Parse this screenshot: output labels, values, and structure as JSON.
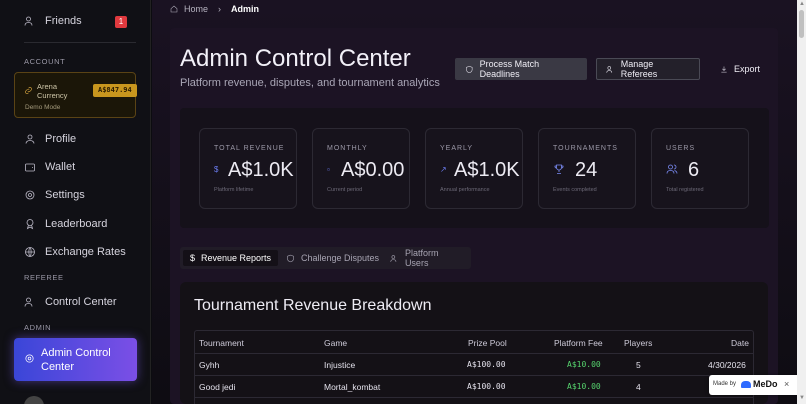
{
  "sidebar": {
    "friends": {
      "label": "Friends",
      "badge": "1"
    },
    "account_section": "ACCOUNT",
    "currency": {
      "label": "Arena Currency",
      "amount": "A$847.94",
      "mode": "Demo Mode"
    },
    "items": [
      {
        "label": "Profile"
      },
      {
        "label": "Wallet"
      },
      {
        "label": "Settings"
      },
      {
        "label": "Leaderboard"
      },
      {
        "label": "Exchange Rates"
      }
    ],
    "referee_section": "REFEREE",
    "control_center": "Control Center",
    "admin_section": "ADMIN",
    "admin_control_center": "Admin Control Center"
  },
  "breadcrumb": {
    "home": "Home",
    "current": "Admin"
  },
  "header": {
    "title": "Admin Control Center",
    "subtitle": "Platform revenue, disputes, and tournament analytics",
    "process_button": "Process Match Deadlines",
    "referees_button": "Manage Referees",
    "export_button": "Export"
  },
  "stats": [
    {
      "label": "TOTAL REVENUE",
      "value": "A$1.0K",
      "note": "Platform lifetime",
      "icon": "dollar-icon"
    },
    {
      "label": "MONTHLY",
      "value": "A$0.00",
      "note": "Current period",
      "icon": "calendar-icon"
    },
    {
      "label": "YEARLY",
      "value": "A$1.0K",
      "note": "Annual performance",
      "icon": "trend-icon"
    },
    {
      "label": "TOURNAMENTS",
      "value": "24",
      "note": "Events completed",
      "icon": "trophy-icon"
    },
    {
      "label": "USERS",
      "value": "6",
      "note": "Total registered",
      "icon": "users-icon"
    }
  ],
  "tabs": [
    {
      "label": "Revenue Reports"
    },
    {
      "label": "Challenge Disputes"
    },
    {
      "label": "Platform Users"
    }
  ],
  "table": {
    "title": "Tournament Revenue Breakdown",
    "columns": [
      "Tournament",
      "Game",
      "Prize Pool",
      "Platform Fee",
      "Players",
      "Date"
    ],
    "rows": [
      {
        "tournament": "Gyhh",
        "game": "Injustice",
        "prize": "A$100.00",
        "fee": "A$10.00",
        "players": "5",
        "date": "4/30/2026"
      },
      {
        "tournament": "Good jedi",
        "game": "Mortal_kombat",
        "prize": "A$100.00",
        "fee": "A$10.00",
        "players": "4",
        "date": ""
      }
    ]
  },
  "medo": {
    "made_by": "Made by",
    "brand": "MeDo",
    "close": "×"
  },
  "colors": {
    "accent": "#5b5be8",
    "fee": "#56d46e",
    "currency": "#c8961e",
    "badge": "#e0393e"
  }
}
